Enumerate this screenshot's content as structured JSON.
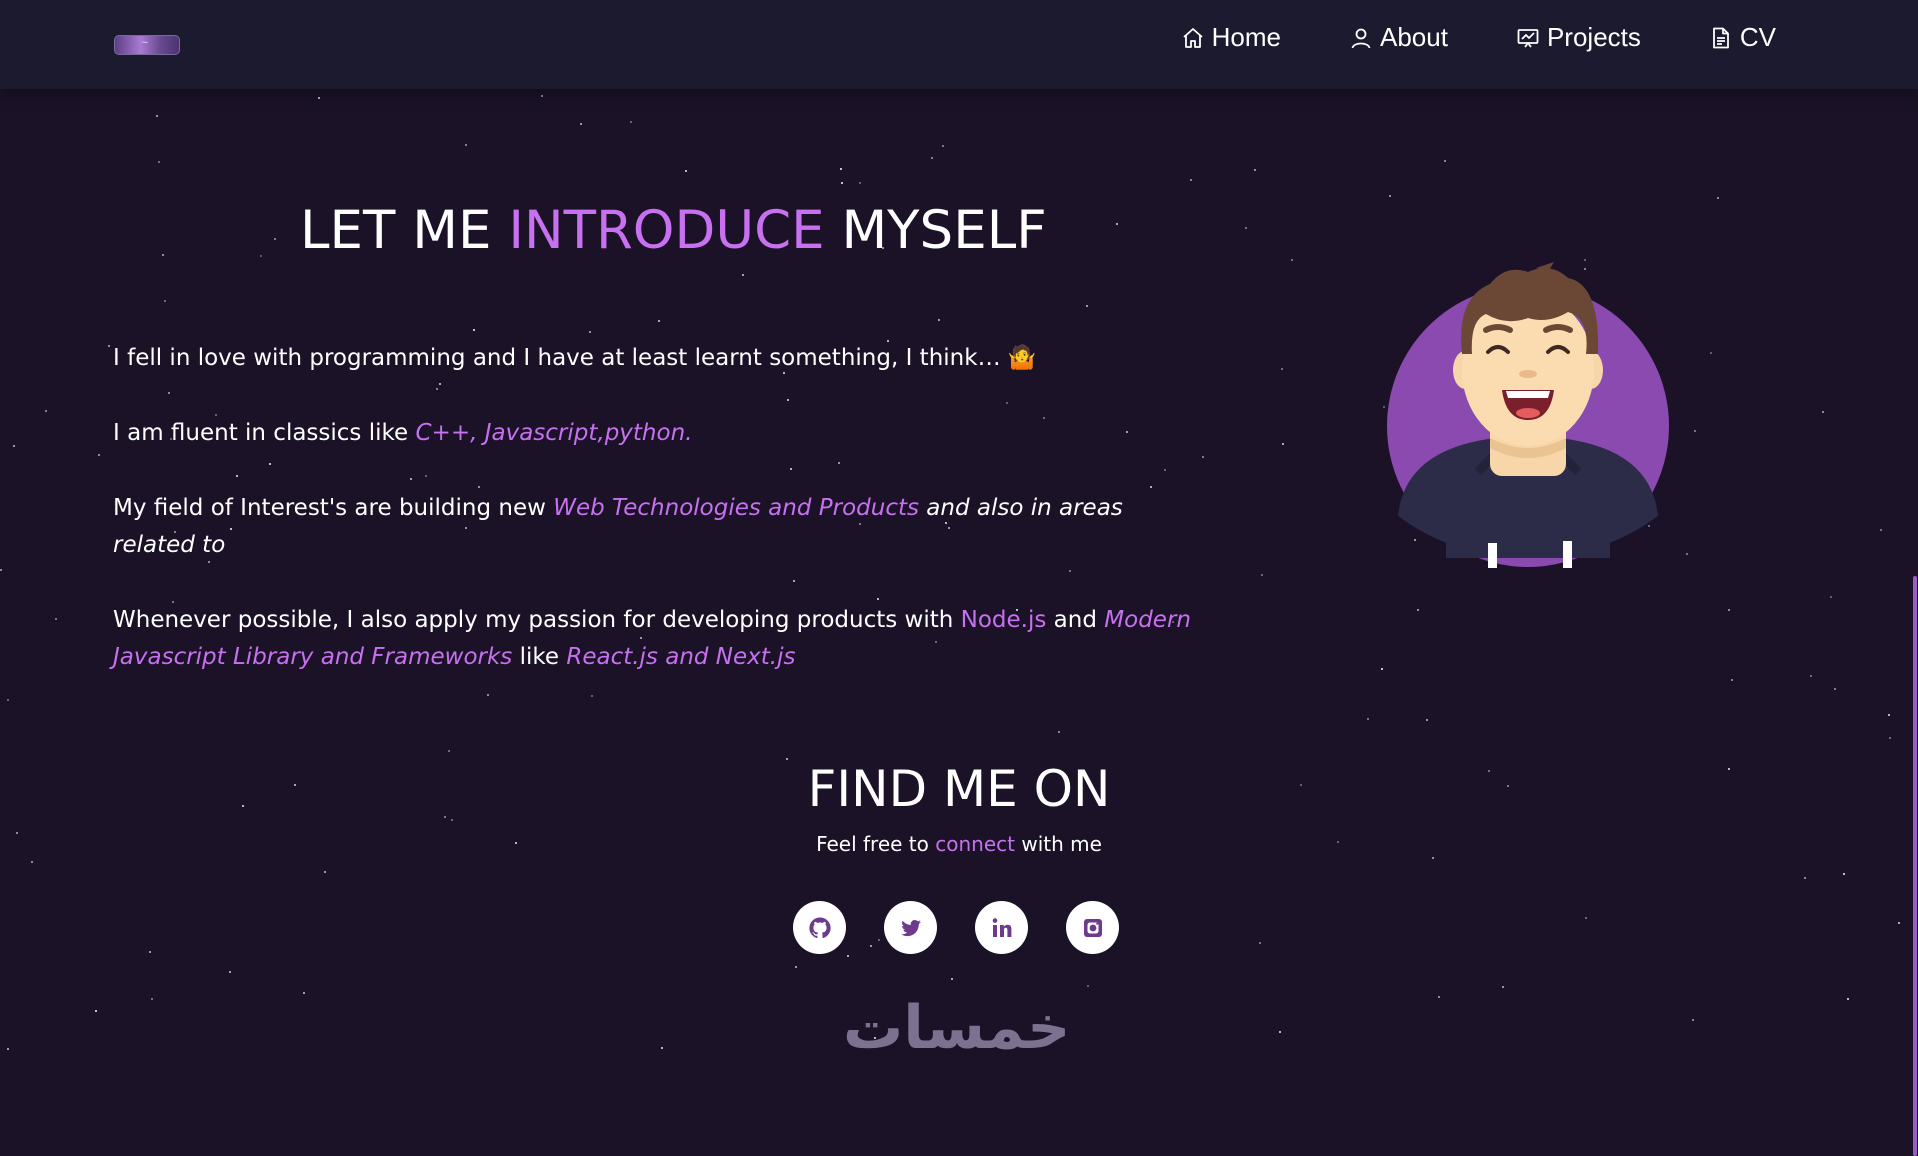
{
  "navbar": {
    "logo_icon": "logo",
    "items": [
      {
        "label": "Home",
        "icon": "home-icon"
      },
      {
        "label": "About",
        "icon": "user-icon"
      },
      {
        "label": "Projects",
        "icon": "projects-icon"
      },
      {
        "label": "CV",
        "icon": "document-icon"
      }
    ]
  },
  "intro": {
    "title_part1": "LET ME ",
    "title_highlight": "INTRODUCE",
    "title_part2": " MYSELF",
    "p1_text": "I fell in love with programming and I have at least learnt something, I think… ",
    "p1_emoji": "🤷",
    "p2_text": "I am fluent in classics like ",
    "p2_highlight": "C++, Javascript,python.",
    "p3_text": "My field of Interest's are building new  ",
    "p3_highlight": "Web Technologies and Products",
    "p3_italic": " and also in areas related to",
    "p4_text": "Whenever possible, I also apply my passion for developing products with ",
    "p4_highlight1": "Node.js",
    "p4_mid": " and ",
    "p4_highlight2": "Modern Javascript Library and Frameworks",
    "p4_like": "  like ",
    "p4_highlight3": "React.js and Next.js"
  },
  "find_me": {
    "title": "FIND ME ON",
    "sub_prefix": "Feel free to ",
    "sub_link": "connect",
    "sub_suffix": " with me",
    "socials": [
      "github-icon",
      "twitter-icon",
      "linkedin-icon",
      "instagram-icon"
    ]
  },
  "watermark": "خمسات",
  "colors": {
    "accent": "#c770f0",
    "background": "#1b1228",
    "navbar": "#1b1a2e",
    "avatar_circle": "#8a4aaf",
    "icon": "#6d3a8e"
  }
}
